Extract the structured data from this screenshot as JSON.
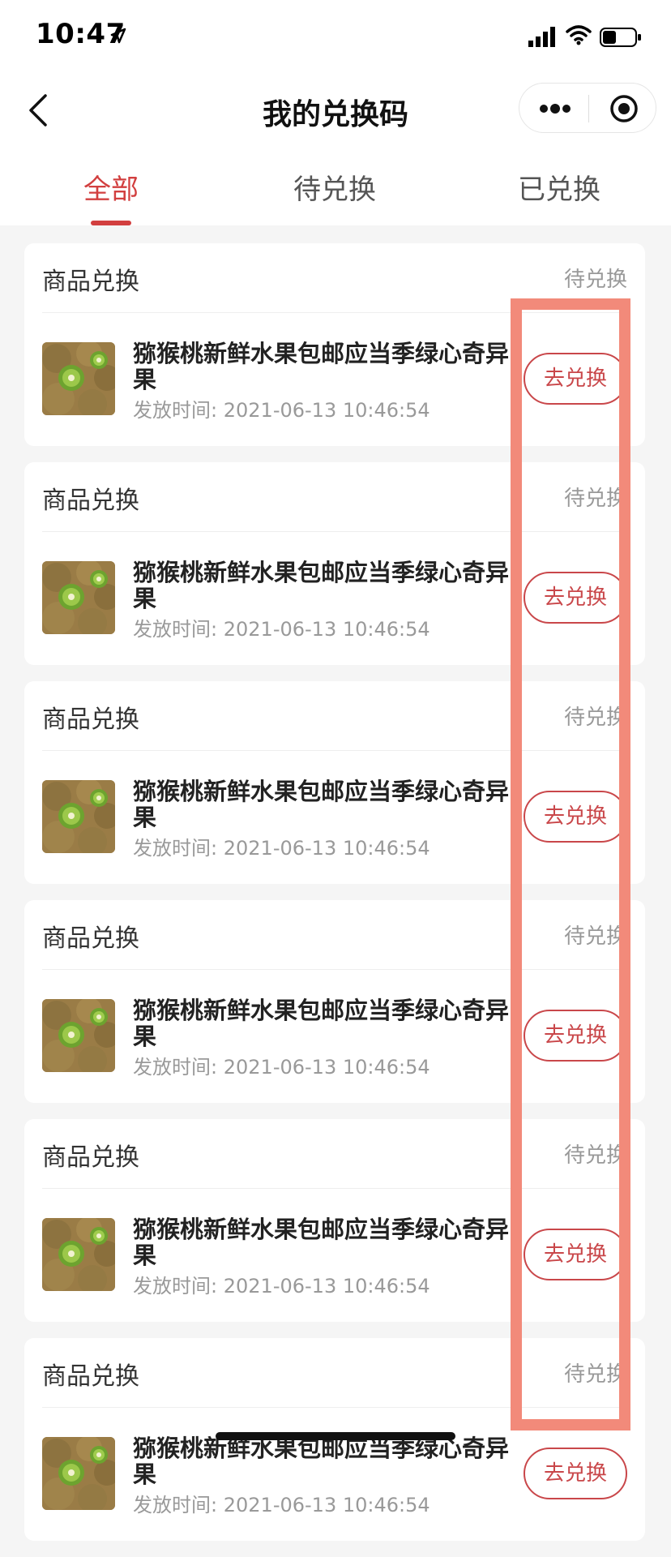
{
  "status_bar": {
    "time": "10:47",
    "icons": [
      "location-arrow-icon",
      "signal-icon",
      "wifi-icon",
      "battery-icon"
    ]
  },
  "nav": {
    "back_icon": "chevron-left-icon",
    "title": "我的兑换码",
    "capsule_icons": [
      "more-dots-icon",
      "record-target-icon"
    ]
  },
  "tabs": [
    {
      "label": "全部",
      "active": true
    },
    {
      "label": "待兑换",
      "active": false
    },
    {
      "label": "已兑换",
      "active": false
    }
  ],
  "cards": [
    {
      "type": "商品兑换",
      "status": "待兑换",
      "product_title": "猕猴桃新鲜水果包邮应当季绿心奇异果",
      "time_label": "发放时间:",
      "time_value": "2021-06-13 10:46:54",
      "button_label": "去兑换"
    },
    {
      "type": "商品兑换",
      "status": "待兑换",
      "product_title": "猕猴桃新鲜水果包邮应当季绿心奇异果",
      "time_label": "发放时间:",
      "time_value": "2021-06-13 10:46:54",
      "button_label": "去兑换"
    },
    {
      "type": "商品兑换",
      "status": "待兑换",
      "product_title": "猕猴桃新鲜水果包邮应当季绿心奇异果",
      "time_label": "发放时间:",
      "time_value": "2021-06-13 10:46:54",
      "button_label": "去兑换"
    },
    {
      "type": "商品兑换",
      "status": "待兑换",
      "product_title": "猕猴桃新鲜水果包邮应当季绿心奇异果",
      "time_label": "发放时间:",
      "time_value": "2021-06-13 10:46:54",
      "button_label": "去兑换"
    },
    {
      "type": "商品兑换",
      "status": "待兑换",
      "product_title": "猕猴桃新鲜水果包邮应当季绿心奇异果",
      "time_label": "发放时间:",
      "time_value": "2021-06-13 10:46:54",
      "button_label": "去兑换"
    },
    {
      "type": "商品兑换",
      "status": "待兑换",
      "product_title": "猕猴桃新鲜水果包邮应当季绿心奇异果",
      "time_label": "发放时间:",
      "time_value": "2021-06-13 10:46:54",
      "button_label": "去兑换"
    }
  ],
  "colors": {
    "accent": "#d23f3f",
    "highlight_box": "#f28a7a",
    "background": "#f5f5f5"
  }
}
